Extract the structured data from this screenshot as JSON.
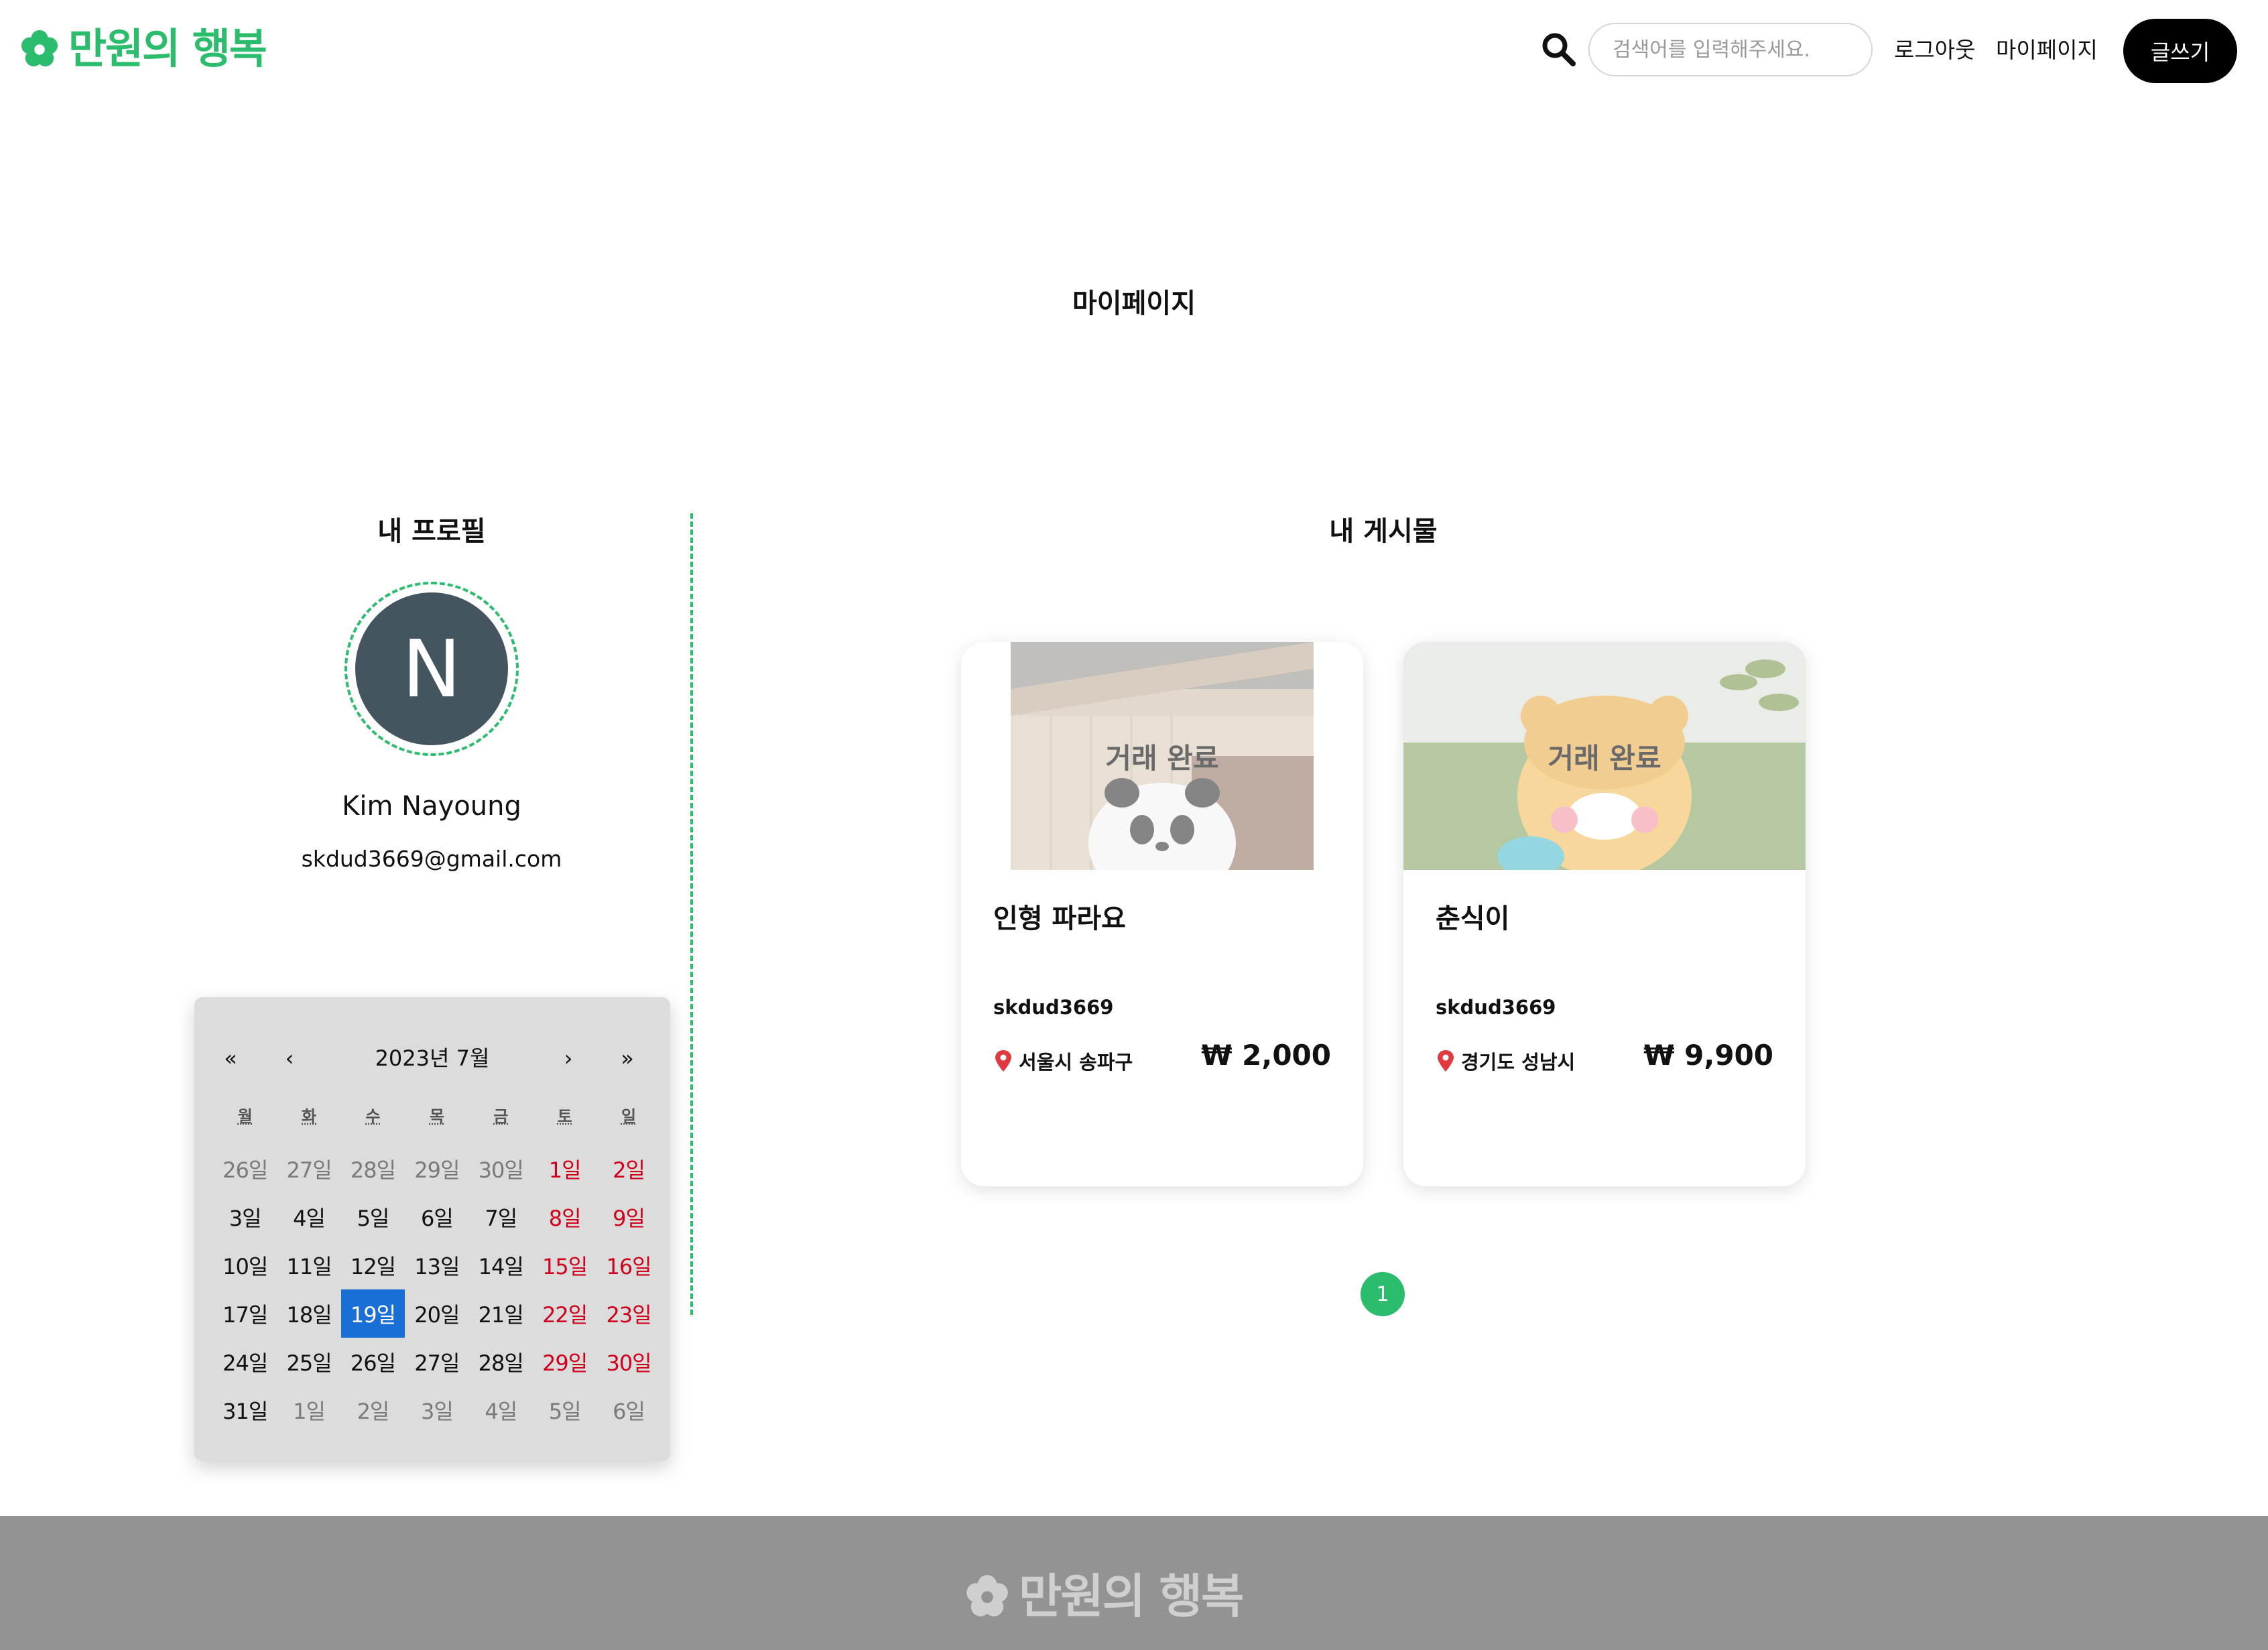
{
  "brand": {
    "name": "만원의 행복",
    "color": "#2bbc6d"
  },
  "header": {
    "search_placeholder": "검색어를 입력해주세요.",
    "logout_label": "로그아웃",
    "mypage_label": "마이페이지",
    "write_label": "글쓰기"
  },
  "page_title": "마이페이지",
  "profile": {
    "title": "내 프로필",
    "avatar_initial": "N",
    "name": "Kim Nayoung",
    "email": "skdud3669@gmail.com"
  },
  "calendar": {
    "nav_first": "«",
    "nav_prev": "‹",
    "label": "2023년 7월",
    "nav_next": "›",
    "nav_last": "»",
    "weekdays": [
      "월",
      "화",
      "수",
      "목",
      "금",
      "토",
      "일"
    ],
    "selected_day": "19일",
    "weeks": [
      [
        "26일",
        "27일",
        "28일",
        "29일",
        "30일",
        "1일",
        "2일"
      ],
      [
        "3일",
        "4일",
        "5일",
        "6일",
        "7일",
        "8일",
        "9일"
      ],
      [
        "10일",
        "11일",
        "12일",
        "13일",
        "14일",
        "15일",
        "16일"
      ],
      [
        "17일",
        "18일",
        "19일",
        "20일",
        "21일",
        "22일",
        "23일"
      ],
      [
        "24일",
        "25일",
        "26일",
        "27일",
        "28일",
        "29일",
        "30일"
      ],
      [
        "31일",
        "1일",
        "2일",
        "3일",
        "4일",
        "5일",
        "6일"
      ]
    ],
    "colors": {
      "weekend": "#d0021b",
      "selected": "#1a6fd6"
    }
  },
  "posts": {
    "title": "내 게시물",
    "items": [
      {
        "status": "거래 완료",
        "title": "인형 파라요",
        "seller": "skdud3669",
        "location": "서울시 송파구",
        "price": "₩ 2,000",
        "image_icon": "panda-plush-photo"
      },
      {
        "status": "거래 완료",
        "title": "춘식이",
        "seller": "skdud3669",
        "location": "경기도 성남시",
        "price": "₩ 9,900",
        "image_icon": "choonsik-plush-photo"
      }
    ],
    "pagination": {
      "current": "1"
    }
  },
  "footer": {
    "brand": "만원의 행복"
  }
}
